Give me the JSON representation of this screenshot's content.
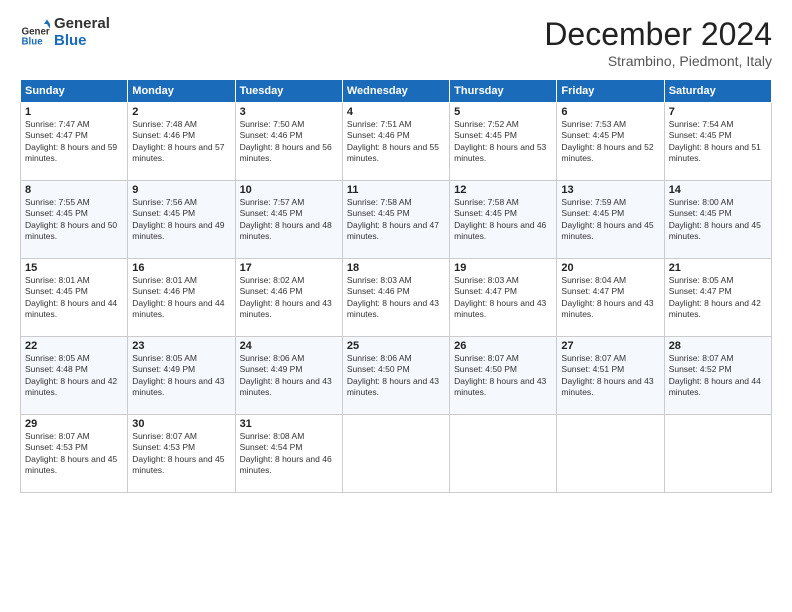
{
  "logo": {
    "line1": "General",
    "line2": "Blue"
  },
  "header": {
    "month": "December 2024",
    "location": "Strambino, Piedmont, Italy"
  },
  "weekdays": [
    "Sunday",
    "Monday",
    "Tuesday",
    "Wednesday",
    "Thursday",
    "Friday",
    "Saturday"
  ],
  "days": [
    {
      "num": "1",
      "sunrise": "7:47 AM",
      "sunset": "4:47 PM",
      "daylight": "8 hours and 59 minutes."
    },
    {
      "num": "2",
      "sunrise": "7:48 AM",
      "sunset": "4:46 PM",
      "daylight": "8 hours and 57 minutes."
    },
    {
      "num": "3",
      "sunrise": "7:50 AM",
      "sunset": "4:46 PM",
      "daylight": "8 hours and 56 minutes."
    },
    {
      "num": "4",
      "sunrise": "7:51 AM",
      "sunset": "4:46 PM",
      "daylight": "8 hours and 55 minutes."
    },
    {
      "num": "5",
      "sunrise": "7:52 AM",
      "sunset": "4:45 PM",
      "daylight": "8 hours and 53 minutes."
    },
    {
      "num": "6",
      "sunrise": "7:53 AM",
      "sunset": "4:45 PM",
      "daylight": "8 hours and 52 minutes."
    },
    {
      "num": "7",
      "sunrise": "7:54 AM",
      "sunset": "4:45 PM",
      "daylight": "8 hours and 51 minutes."
    },
    {
      "num": "8",
      "sunrise": "7:55 AM",
      "sunset": "4:45 PM",
      "daylight": "8 hours and 50 minutes."
    },
    {
      "num": "9",
      "sunrise": "7:56 AM",
      "sunset": "4:45 PM",
      "daylight": "8 hours and 49 minutes."
    },
    {
      "num": "10",
      "sunrise": "7:57 AM",
      "sunset": "4:45 PM",
      "daylight": "8 hours and 48 minutes."
    },
    {
      "num": "11",
      "sunrise": "7:58 AM",
      "sunset": "4:45 PM",
      "daylight": "8 hours and 47 minutes."
    },
    {
      "num": "12",
      "sunrise": "7:58 AM",
      "sunset": "4:45 PM",
      "daylight": "8 hours and 46 minutes."
    },
    {
      "num": "13",
      "sunrise": "7:59 AM",
      "sunset": "4:45 PM",
      "daylight": "8 hours and 45 minutes."
    },
    {
      "num": "14",
      "sunrise": "8:00 AM",
      "sunset": "4:45 PM",
      "daylight": "8 hours and 45 minutes."
    },
    {
      "num": "15",
      "sunrise": "8:01 AM",
      "sunset": "4:45 PM",
      "daylight": "8 hours and 44 minutes."
    },
    {
      "num": "16",
      "sunrise": "8:01 AM",
      "sunset": "4:46 PM",
      "daylight": "8 hours and 44 minutes."
    },
    {
      "num": "17",
      "sunrise": "8:02 AM",
      "sunset": "4:46 PM",
      "daylight": "8 hours and 43 minutes."
    },
    {
      "num": "18",
      "sunrise": "8:03 AM",
      "sunset": "4:46 PM",
      "daylight": "8 hours and 43 minutes."
    },
    {
      "num": "19",
      "sunrise": "8:03 AM",
      "sunset": "4:47 PM",
      "daylight": "8 hours and 43 minutes."
    },
    {
      "num": "20",
      "sunrise": "8:04 AM",
      "sunset": "4:47 PM",
      "daylight": "8 hours and 43 minutes."
    },
    {
      "num": "21",
      "sunrise": "8:05 AM",
      "sunset": "4:47 PM",
      "daylight": "8 hours and 42 minutes."
    },
    {
      "num": "22",
      "sunrise": "8:05 AM",
      "sunset": "4:48 PM",
      "daylight": "8 hours and 42 minutes."
    },
    {
      "num": "23",
      "sunrise": "8:05 AM",
      "sunset": "4:49 PM",
      "daylight": "8 hours and 43 minutes."
    },
    {
      "num": "24",
      "sunrise": "8:06 AM",
      "sunset": "4:49 PM",
      "daylight": "8 hours and 43 minutes."
    },
    {
      "num": "25",
      "sunrise": "8:06 AM",
      "sunset": "4:50 PM",
      "daylight": "8 hours and 43 minutes."
    },
    {
      "num": "26",
      "sunrise": "8:07 AM",
      "sunset": "4:50 PM",
      "daylight": "8 hours and 43 minutes."
    },
    {
      "num": "27",
      "sunrise": "8:07 AM",
      "sunset": "4:51 PM",
      "daylight": "8 hours and 43 minutes."
    },
    {
      "num": "28",
      "sunrise": "8:07 AM",
      "sunset": "4:52 PM",
      "daylight": "8 hours and 44 minutes."
    },
    {
      "num": "29",
      "sunrise": "8:07 AM",
      "sunset": "4:53 PM",
      "daylight": "8 hours and 45 minutes."
    },
    {
      "num": "30",
      "sunrise": "8:07 AM",
      "sunset": "4:53 PM",
      "daylight": "8 hours and 45 minutes."
    },
    {
      "num": "31",
      "sunrise": "8:08 AM",
      "sunset": "4:54 PM",
      "daylight": "8 hours and 46 minutes."
    }
  ],
  "labels": {
    "sunrise": "Sunrise:",
    "sunset": "Sunset:",
    "daylight": "Daylight:"
  },
  "colors": {
    "header_bg": "#1a6bba",
    "logo_blue": "#1a6bba"
  }
}
